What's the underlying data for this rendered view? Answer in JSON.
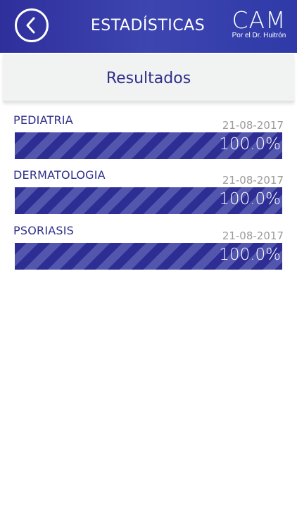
{
  "header": {
    "title": "ESTADÍSTICAS",
    "back_icon": "chevron-left-icon",
    "logo": {
      "main": "CAM",
      "sub": "Por el Dr. Huitrón"
    }
  },
  "subheader": {
    "title": "Resultados"
  },
  "results": [
    {
      "name": "PEDIATRIA",
      "date": "21-08-2017",
      "percent": 100.0,
      "label": "100.0%"
    },
    {
      "name": "DERMATOLOGIA",
      "date": "21-08-2017",
      "percent": 100.0,
      "label": "100.0%"
    },
    {
      "name": "PSORIASIS",
      "date": "21-08-2017",
      "percent": 100.0,
      "label": "100.0%"
    }
  ],
  "colors": {
    "header_bg": "#3340aa",
    "bar_dark": "#2d2d94",
    "bar_light": "#5257ad",
    "text_primary": "#2e2f8a",
    "text_muted": "#9a9a9a"
  }
}
